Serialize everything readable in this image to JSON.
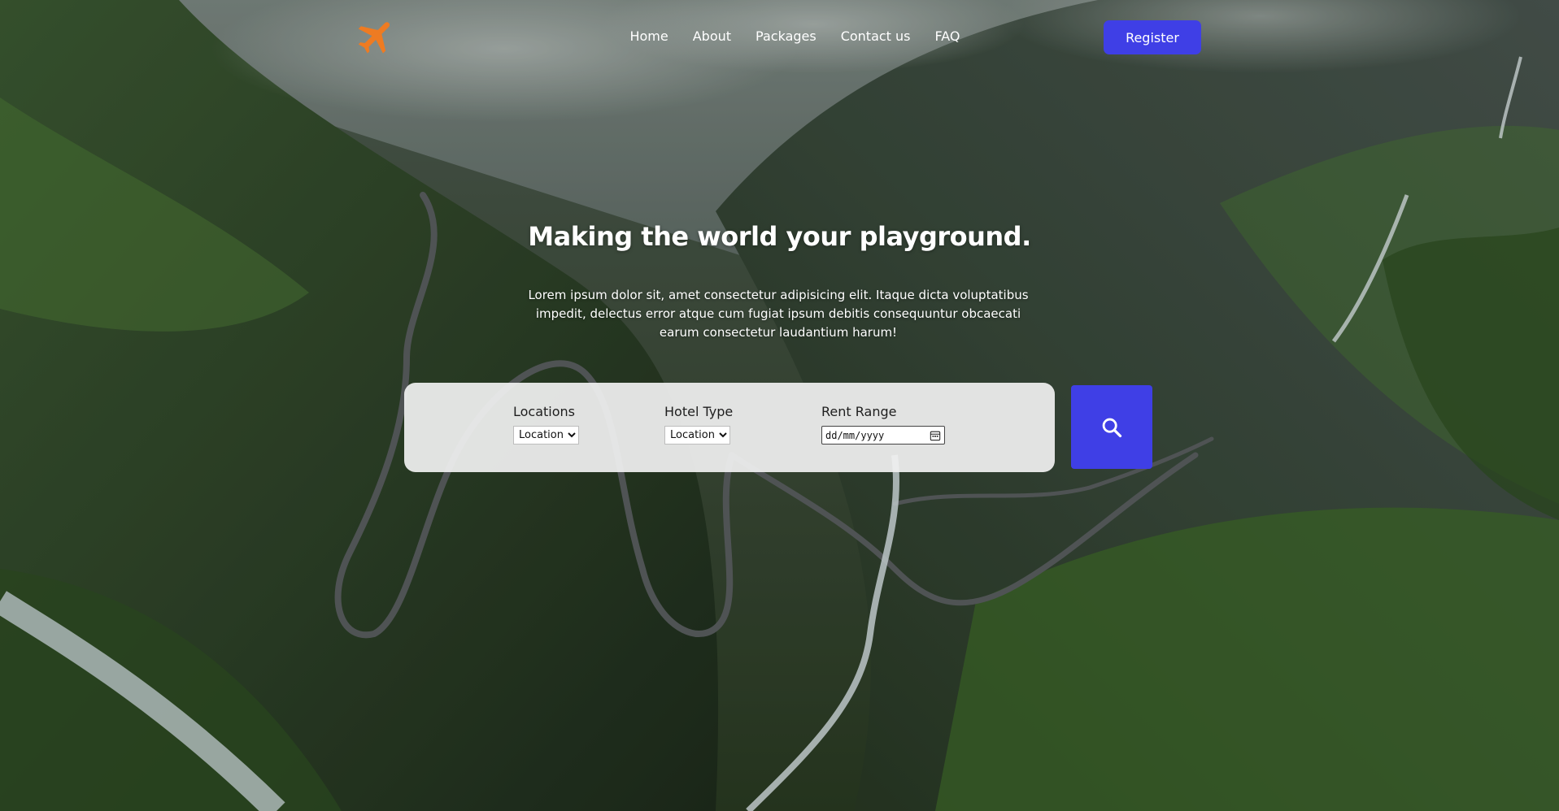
{
  "nav": {
    "items": [
      {
        "label": "Home"
      },
      {
        "label": "About"
      },
      {
        "label": "Packages"
      },
      {
        "label": "Contact us"
      },
      {
        "label": "FAQ"
      }
    ],
    "register_label": "Register"
  },
  "hero": {
    "title": "Making the world your playground.",
    "description": "Lorem ipsum dolor sit, amet consectetur adipisicing elit. Itaque dicta voluptatibus impedit, delectus error atque cum fugiat ipsum debitis consequuntur obcaecati earum consectetur laudantium harum!"
  },
  "search": {
    "locations": {
      "label": "Locations",
      "selected": "Location"
    },
    "hotel_type": {
      "label": "Hotel Type",
      "selected": "Location"
    },
    "rent_range": {
      "label": "Rent Range",
      "placeholder": "dd/mm/yyyy"
    }
  },
  "icons": {
    "logo": "airplane-icon",
    "search": "search-icon",
    "calendar": "calendar-icon"
  },
  "colors": {
    "accent": "#3f3fe6",
    "logo": "#ee7b22",
    "panel": "#f0f0f0"
  }
}
